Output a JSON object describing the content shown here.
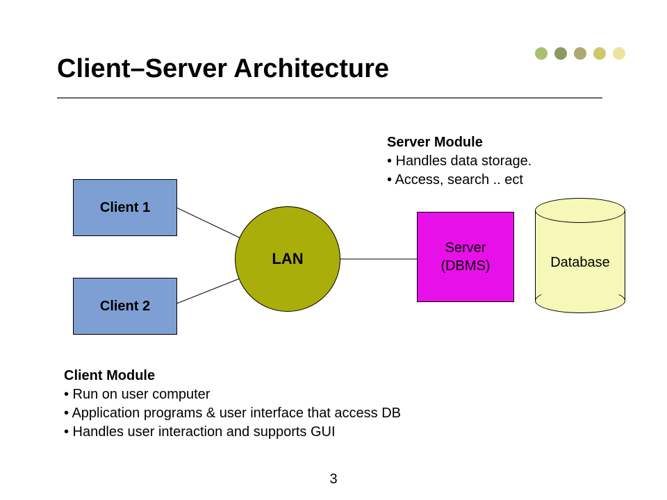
{
  "title": "Client–Server Architecture",
  "dots": [
    "#a9c06f",
    "#8a9960",
    "#ada96f",
    "#cfc86b",
    "#ece39f"
  ],
  "nodes": {
    "client1": "Client 1",
    "client2": "Client 2",
    "lan": "LAN",
    "server_line1": "Server",
    "server_line2": "(DBMS)",
    "database": "Database"
  },
  "annotations": {
    "server": {
      "heading": "Server Module",
      "b1": "• Handles data storage.",
      "b2": "• Access, search .. ect"
    },
    "client": {
      "heading": "Client Module",
      "b1": "• Run on user computer",
      "b2": "• Application programs & user interface that access DB",
      "b3": "• Handles user interaction and supports GUI"
    }
  },
  "page_number": "3"
}
